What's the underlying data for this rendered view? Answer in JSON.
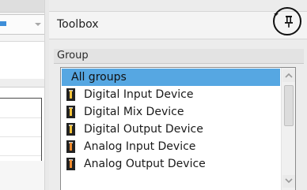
{
  "toolbox": {
    "title": "Toolbox",
    "group_label": "Group",
    "items": [
      {
        "label": "All groups",
        "selected": true,
        "icon": ""
      },
      {
        "label": "Digital Input Device",
        "selected": false,
        "icon": "digital-input-device-icon"
      },
      {
        "label": "Digital Mix Device",
        "selected": false,
        "icon": "digital-mix-device-icon"
      },
      {
        "label": "Digital Output Device",
        "selected": false,
        "icon": "digital-output-device-icon"
      },
      {
        "label": "Analog Input Device",
        "selected": false,
        "icon": "analog-input-device-icon"
      },
      {
        "label": "Analog Output Device",
        "selected": false,
        "icon": "analog-output-device-icon"
      }
    ]
  },
  "colors": {
    "selection": "#56a7e2",
    "panel_background": "#ececec",
    "highlight_circle": "#111111"
  }
}
